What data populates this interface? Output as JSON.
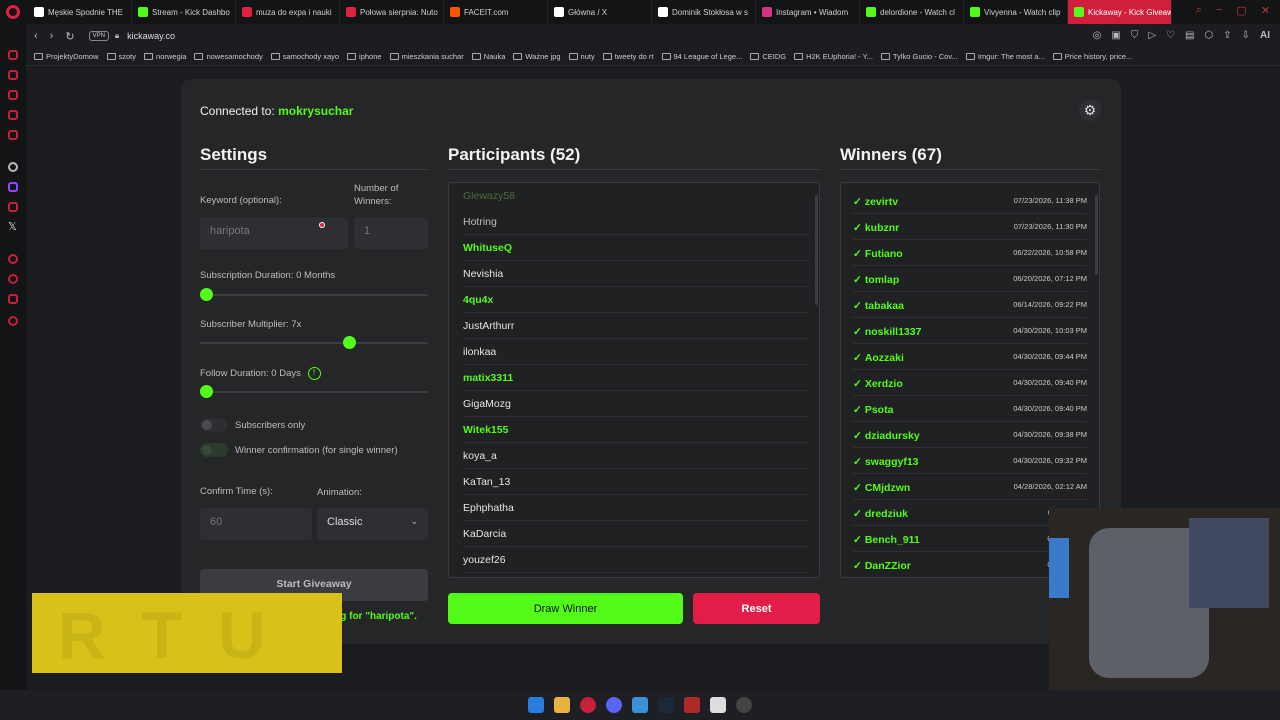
{
  "browser": {
    "tabs": [
      {
        "label": "Męskie Spodnie THE",
        "color": "#ffffff"
      },
      {
        "label": "Stream - Kick Dashbo",
        "color": "#53fc18"
      },
      {
        "label": "muza do expa i nauki",
        "color": "#e0213d"
      },
      {
        "label": "Połowa sierpnia: Nuto",
        "color": "#e0213d"
      },
      {
        "label": "FACEIT.com",
        "color": "#ff5500"
      },
      {
        "label": "Główna / X",
        "color": "#ffffff"
      },
      {
        "label": "Dominik Stokłosa w s",
        "color": "#ffffff"
      },
      {
        "label": "Instagram • Wiadom",
        "color": "#d63384"
      },
      {
        "label": "delordione - Watch cl",
        "color": "#53fc18"
      },
      {
        "label": "Vivyenna - Watch clip",
        "color": "#53fc18"
      },
      {
        "label": "Kickaway - Kick Giveaway",
        "color": "#53fc18",
        "active": true
      }
    ],
    "vpn": "VPN",
    "url": "kickaway.co",
    "bookmarks": [
      "ProjektyDomow",
      "szoty",
      "norwegia",
      "nowesamochody",
      "samochody xayo",
      "iphone",
      "mieszkania suchar",
      "Nauka",
      "Ważne jpg",
      "nuty",
      "tweety do rt",
      "94 League of Lege...",
      "CEIDG",
      "H2K EUphoria! - Y...",
      "Tylko Gucio - Cov...",
      "Imgur: The most a...",
      "Price history, price..."
    ],
    "addr_ai": "AI"
  },
  "header": {
    "connected_prefix": "Connected to:",
    "channel": "mokrysuchar"
  },
  "settings": {
    "title": "Settings",
    "keyword_label": "Keyword (optional):",
    "keyword_value": "haripota",
    "winners_label": "Number of Winners:",
    "winners_value": "1",
    "sub_duration_label": "Subscription Duration: 0 Months",
    "sub_duration_value": 0,
    "sub_multiplier_label": "Subscriber Multiplier: 7x",
    "sub_multiplier_value": 7,
    "follow_duration_label": "Follow Duration:",
    "follow_duration_value": "0",
    "follow_duration_unit": "Days",
    "subscribers_only_label": "Subscribers only",
    "winner_confirmation_label": "Winner confirmation (for single winner)",
    "confirm_time_label": "Confirm Time (s):",
    "confirm_time_value": "60",
    "animation_label": "Animation:",
    "animation_value": "Classic",
    "start_button": "Start Giveaway",
    "status": "...ing for \"haripota\"."
  },
  "participants": {
    "title": "Participants (52)",
    "list": [
      {
        "name": "Glewazy58",
        "sub": false,
        "fade": true
      },
      {
        "name": "Hotring",
        "sub": false,
        "grey": true
      },
      {
        "name": "WhituseQ",
        "sub": true
      },
      {
        "name": "Nevishia",
        "sub": false
      },
      {
        "name": "4qu4x",
        "sub": true
      },
      {
        "name": "JustArthurr",
        "sub": false
      },
      {
        "name": "ilonkaa",
        "sub": false
      },
      {
        "name": "matix3311",
        "sub": true
      },
      {
        "name": "GigaMozg",
        "sub": false
      },
      {
        "name": "Witek155",
        "sub": true
      },
      {
        "name": "koya_a",
        "sub": false
      },
      {
        "name": "KaTan_13",
        "sub": false
      },
      {
        "name": "Ephphatha",
        "sub": false
      },
      {
        "name": "KaDarcia",
        "sub": false
      },
      {
        "name": "youzef26",
        "sub": false
      }
    ],
    "draw_button": "Draw Winner",
    "reset_button": "Reset"
  },
  "winners": {
    "title": "Winners (67)",
    "check": "✓",
    "list": [
      {
        "name": "zevirtv",
        "date": "07/23/2026, 11:38 PM"
      },
      {
        "name": "kubznr",
        "date": "07/23/2026, 11:30 PM"
      },
      {
        "name": "Futiano",
        "date": "06/22/2026, 10:58 PM"
      },
      {
        "name": "tomlap",
        "date": "06/20/2026, 07:12 PM"
      },
      {
        "name": "tabakaa",
        "date": "06/14/2026, 09:22 PM"
      },
      {
        "name": "noskill1337",
        "date": "04/30/2026, 10:03 PM"
      },
      {
        "name": "Aozzaki",
        "date": "04/30/2026, 09:44 PM"
      },
      {
        "name": "Xerdzio",
        "date": "04/30/2026, 09:40 PM"
      },
      {
        "name": "Psota",
        "date": "04/30/2026, 09:40 PM"
      },
      {
        "name": "dziadursky",
        "date": "04/30/2026, 09:38 PM"
      },
      {
        "name": "swaggyf13",
        "date": "04/30/2026, 09:32 PM"
      },
      {
        "name": "CMjdzwn",
        "date": "04/28/2026, 02:12 AM"
      },
      {
        "name": "dredziuk",
        "date": "04/11/2026,"
      },
      {
        "name": "Bench_911",
        "date": "04/10/2026,"
      },
      {
        "name": "DanZZior",
        "date": "04/10/2026,"
      }
    ]
  },
  "overlay": {
    "text": "RTU"
  },
  "colors": {
    "accent": "#53fc18",
    "danger": "#e21d48",
    "card": "#252628",
    "bg": "#1b1c1f"
  }
}
